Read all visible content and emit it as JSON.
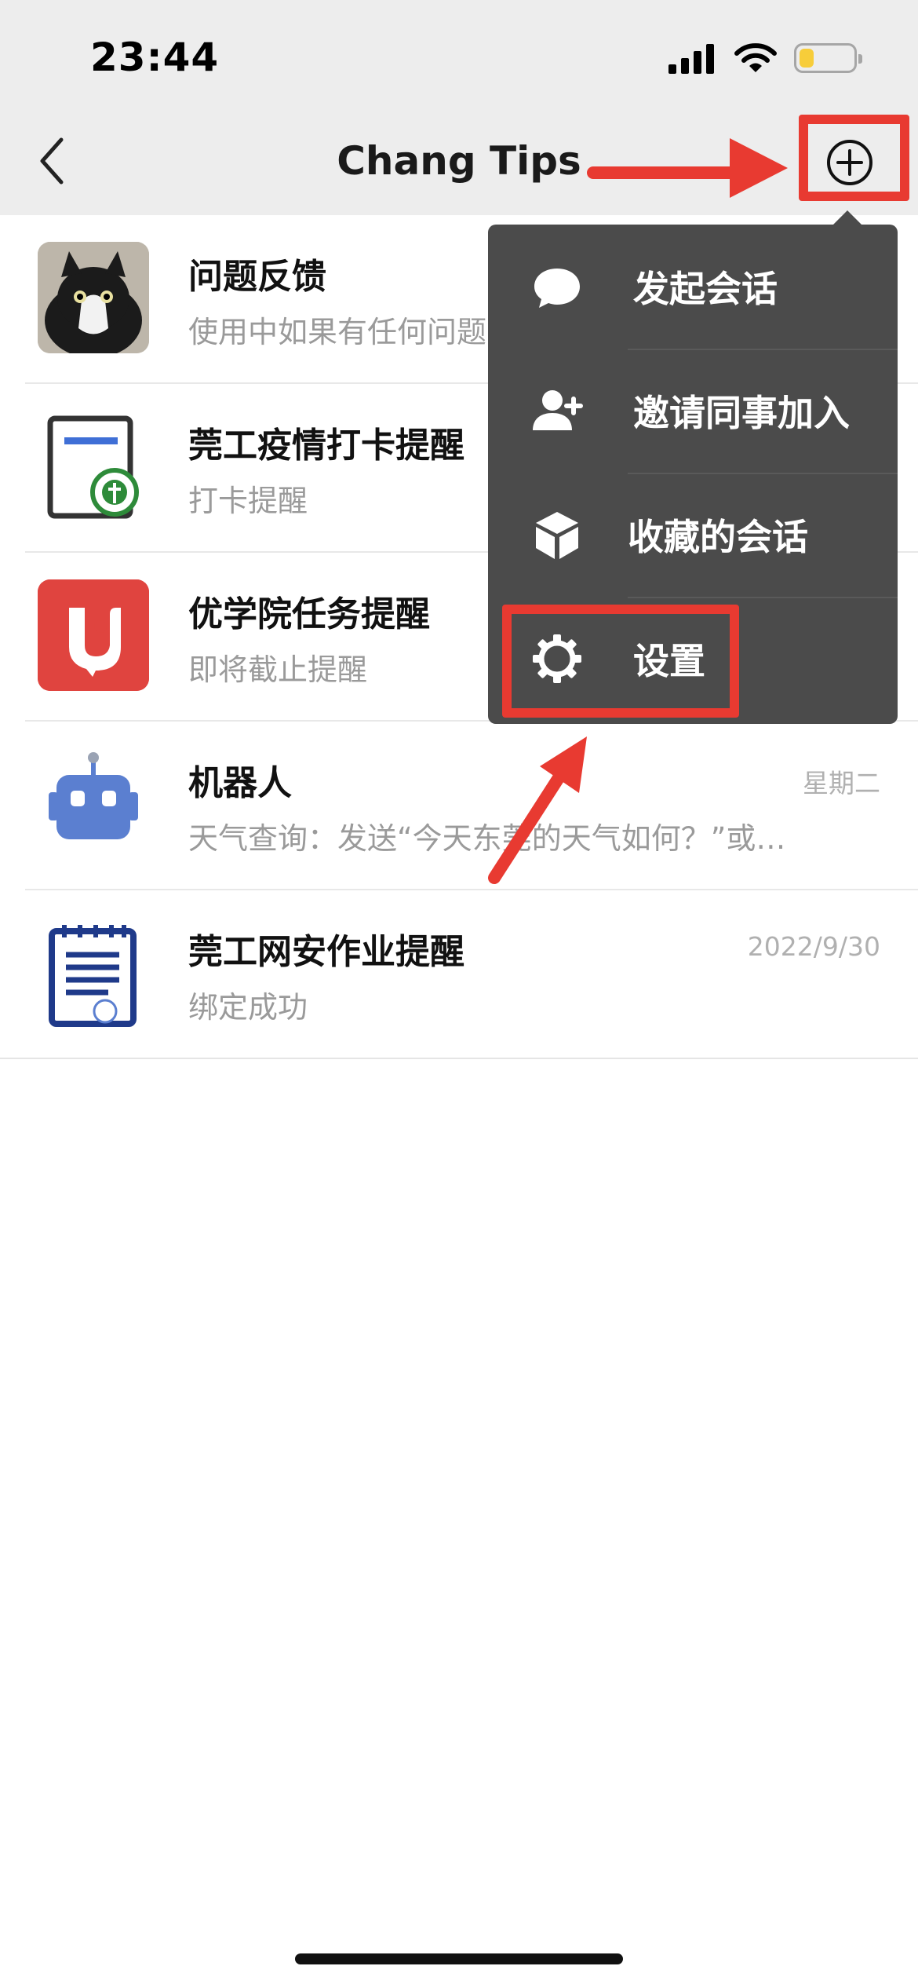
{
  "status_bar": {
    "time": "23:44"
  },
  "nav": {
    "title": "Chang Tips"
  },
  "chats": [
    {
      "name": "问题反馈",
      "preview": "使用中如果有任何问题，欢迎反馈",
      "time": ""
    },
    {
      "name": "莞工疫情打卡提醒",
      "preview": "打卡提醒",
      "time": ""
    },
    {
      "name": "优学院任务提醒",
      "preview": "即将截止提醒",
      "time": ""
    },
    {
      "name": "机器人",
      "preview": "天气查询：发送“今天东莞的天气如何？”或…",
      "time": "星期二"
    },
    {
      "name": "莞工网安作业提醒",
      "preview": "绑定成功",
      "time": "2022/9/30"
    }
  ],
  "menu": {
    "items": [
      {
        "label": "发起会话",
        "icon": "chat-bubble-icon"
      },
      {
        "label": "邀请同事加入",
        "icon": "add-user-icon"
      },
      {
        "label": "收藏的会话",
        "icon": "cube-icon"
      },
      {
        "label": "设置",
        "icon": "gear-icon"
      }
    ]
  },
  "colors": {
    "nav_bg": "#ededed",
    "menu_bg": "#4b4b4b",
    "annotation_red": "#e83a31",
    "battery_fill": "#f7cd3a",
    "secondary_text": "#9a9a9a"
  }
}
